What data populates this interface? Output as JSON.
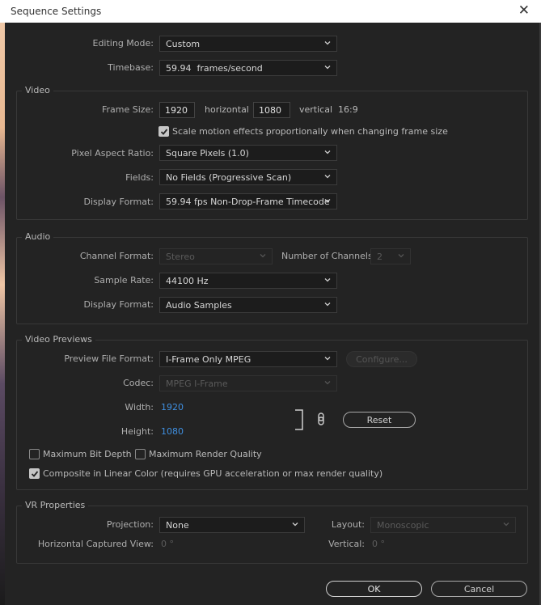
{
  "window": {
    "title": "Sequence Settings",
    "close": "✕"
  },
  "top": {
    "editing_mode_label": "Editing Mode:",
    "editing_mode_value": "Custom",
    "timebase_label": "Timebase:",
    "timebase_value": "59.94  frames/second"
  },
  "video": {
    "title": "Video",
    "frame_size_label": "Frame Size:",
    "width": "1920",
    "horizontal_label": "horizontal",
    "height": "1080",
    "vertical_label": "vertical",
    "aspect": "16:9",
    "scale_motion_label": "Scale motion effects proportionally when changing frame size",
    "scale_motion_checked": true,
    "par_label": "Pixel Aspect Ratio:",
    "par_value": "Square Pixels (1.0)",
    "fields_label": "Fields:",
    "fields_value": "No Fields (Progressive Scan)",
    "display_format_label": "Display Format:",
    "display_format_value": "59.94 fps Non-Drop-Frame Timecode"
  },
  "audio": {
    "title": "Audio",
    "channel_format_label": "Channel Format:",
    "channel_format_value": "Stereo",
    "num_channels_label": "Number of Channels:",
    "num_channels_value": "2",
    "sample_rate_label": "Sample Rate:",
    "sample_rate_value": "44100 Hz",
    "display_format_label": "Display Format:",
    "display_format_value": "Audio Samples"
  },
  "previews": {
    "title": "Video Previews",
    "file_format_label": "Preview File Format:",
    "file_format_value": "I-Frame Only MPEG",
    "configure_label": "Configure...",
    "codec_label": "Codec:",
    "codec_value": "MPEG I-Frame",
    "width_label": "Width:",
    "width_value": "1920",
    "height_label": "Height:",
    "height_value": "1080",
    "reset_label": "Reset",
    "max_bit_depth_label": "Maximum Bit Depth",
    "max_bit_depth_checked": false,
    "max_render_label": "Maximum Render Quality",
    "max_render_checked": false,
    "linear_color_label": "Composite in Linear Color (requires GPU acceleration or max render quality)",
    "linear_color_checked": true
  },
  "vr": {
    "title": "VR Properties",
    "projection_label": "Projection:",
    "projection_value": "None",
    "layout_label": "Layout:",
    "layout_value": "Monoscopic",
    "hcv_label": "Horizontal Captured View:",
    "hcv_value": "0 °",
    "vertical_label": "Vertical:",
    "vertical_value": "0 °"
  },
  "footer": {
    "ok_label": "OK",
    "cancel_label": "Cancel"
  },
  "colors": {
    "accent_blue": "#3f8fe0",
    "dialog_bg": "#232323",
    "titlebar_bg": "#ffffff"
  }
}
